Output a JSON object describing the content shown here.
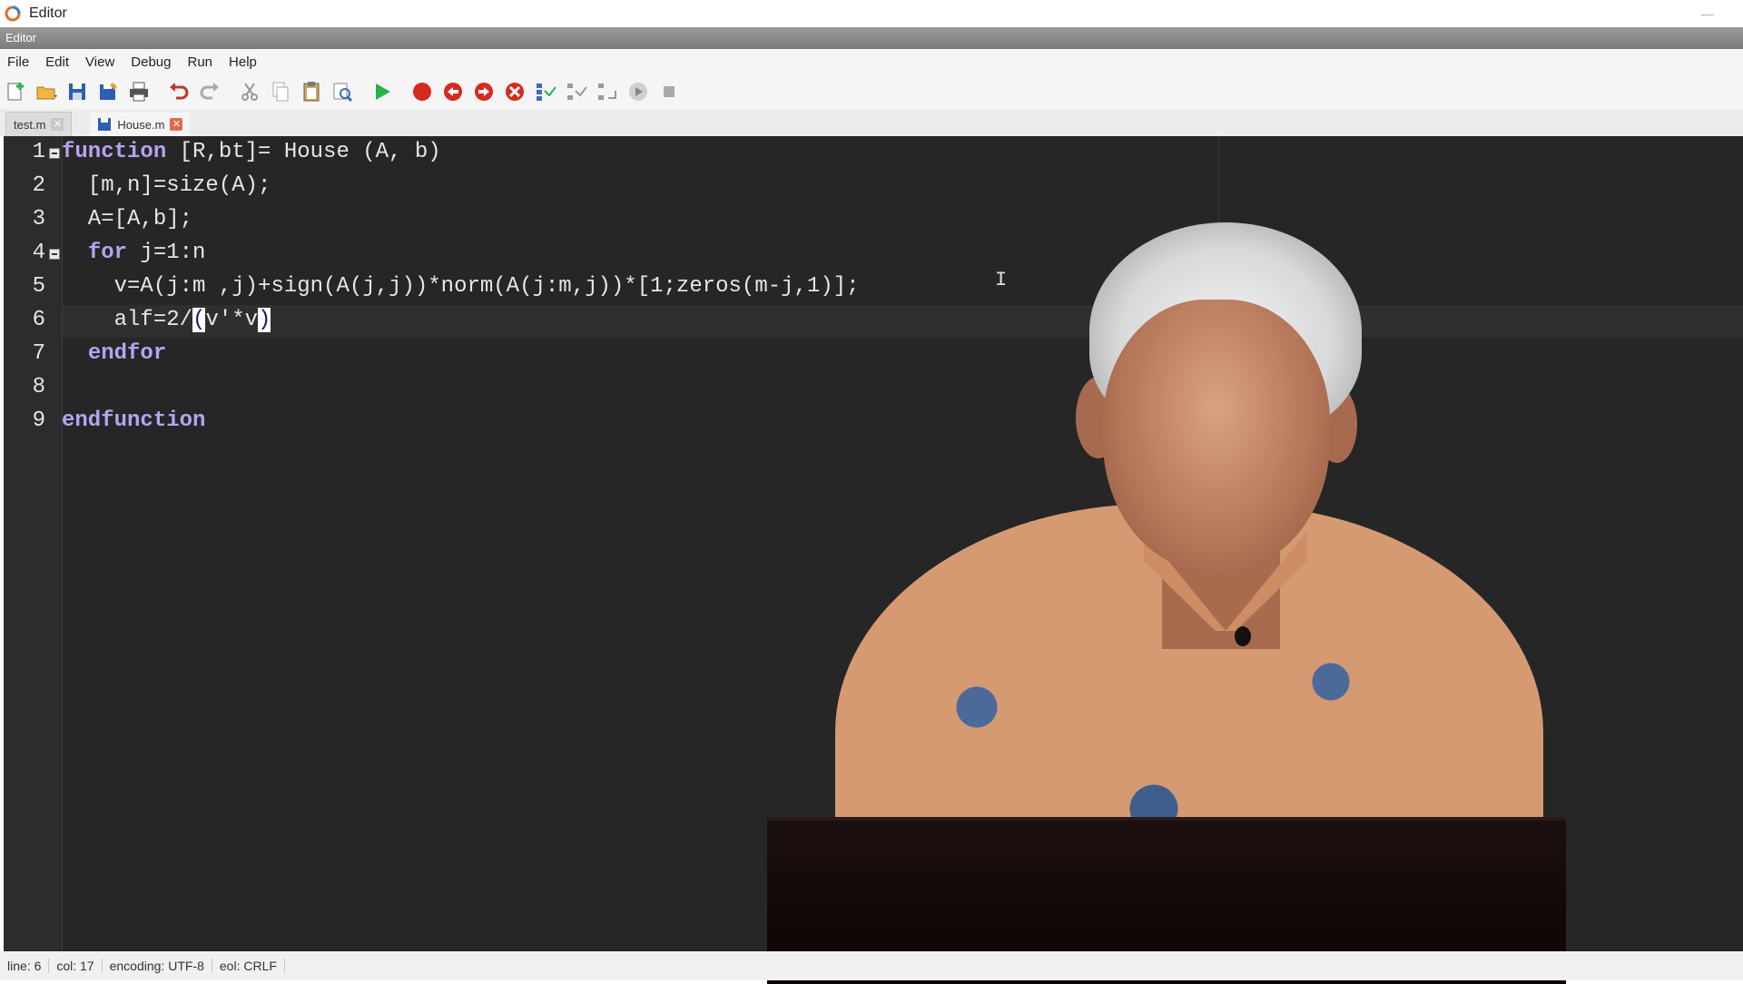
{
  "window": {
    "title": "Editor"
  },
  "dock": {
    "title": "Editor"
  },
  "menu": [
    "File",
    "Edit",
    "View",
    "Debug",
    "Run",
    "Help"
  ],
  "toolbar": {
    "icons": [
      "new-file-icon",
      "open-folder-icon",
      "save-icon",
      "save-as-icon",
      "print-icon",
      "undo-icon",
      "redo-icon",
      "cut-icon",
      "copy-icon",
      "paste-icon",
      "find-replace-icon",
      "run-icon",
      "breakpoint-icon",
      "step-back-icon",
      "step-forward-icon",
      "stop-debug-icon",
      "step-into-icon",
      "step-over-icon",
      "step-out-icon",
      "continue-icon",
      "stop-icon"
    ]
  },
  "tabs": [
    {
      "label": "test.m",
      "active": false
    },
    {
      "label": "House.m",
      "active": true
    }
  ],
  "editor": {
    "line_numbers": [
      "1",
      "2",
      "3",
      "4",
      "5",
      "6",
      "7",
      "8",
      "9"
    ],
    "lines": [
      "function [R,bt]= House (A, b)",
      "  [m,n]=size(A);",
      "  A=[A,b];",
      "  for j=1:n",
      "    v=A(j:m ,j)+sign(A(j,j))*norm(A(j:m,j))*[1;zeros(m-j,1)];",
      "    alf=2/(v'*v)",
      "  endfor",
      "",
      "endfunction"
    ]
  },
  "status": {
    "line": "line: 6",
    "col": "col: 17",
    "encoding": "encoding: UTF-8",
    "eol": "eol: CRLF"
  },
  "colors": {
    "keyword": "#b7a2f2",
    "editor_bg": "#262626",
    "text": "#e6e6e6"
  }
}
